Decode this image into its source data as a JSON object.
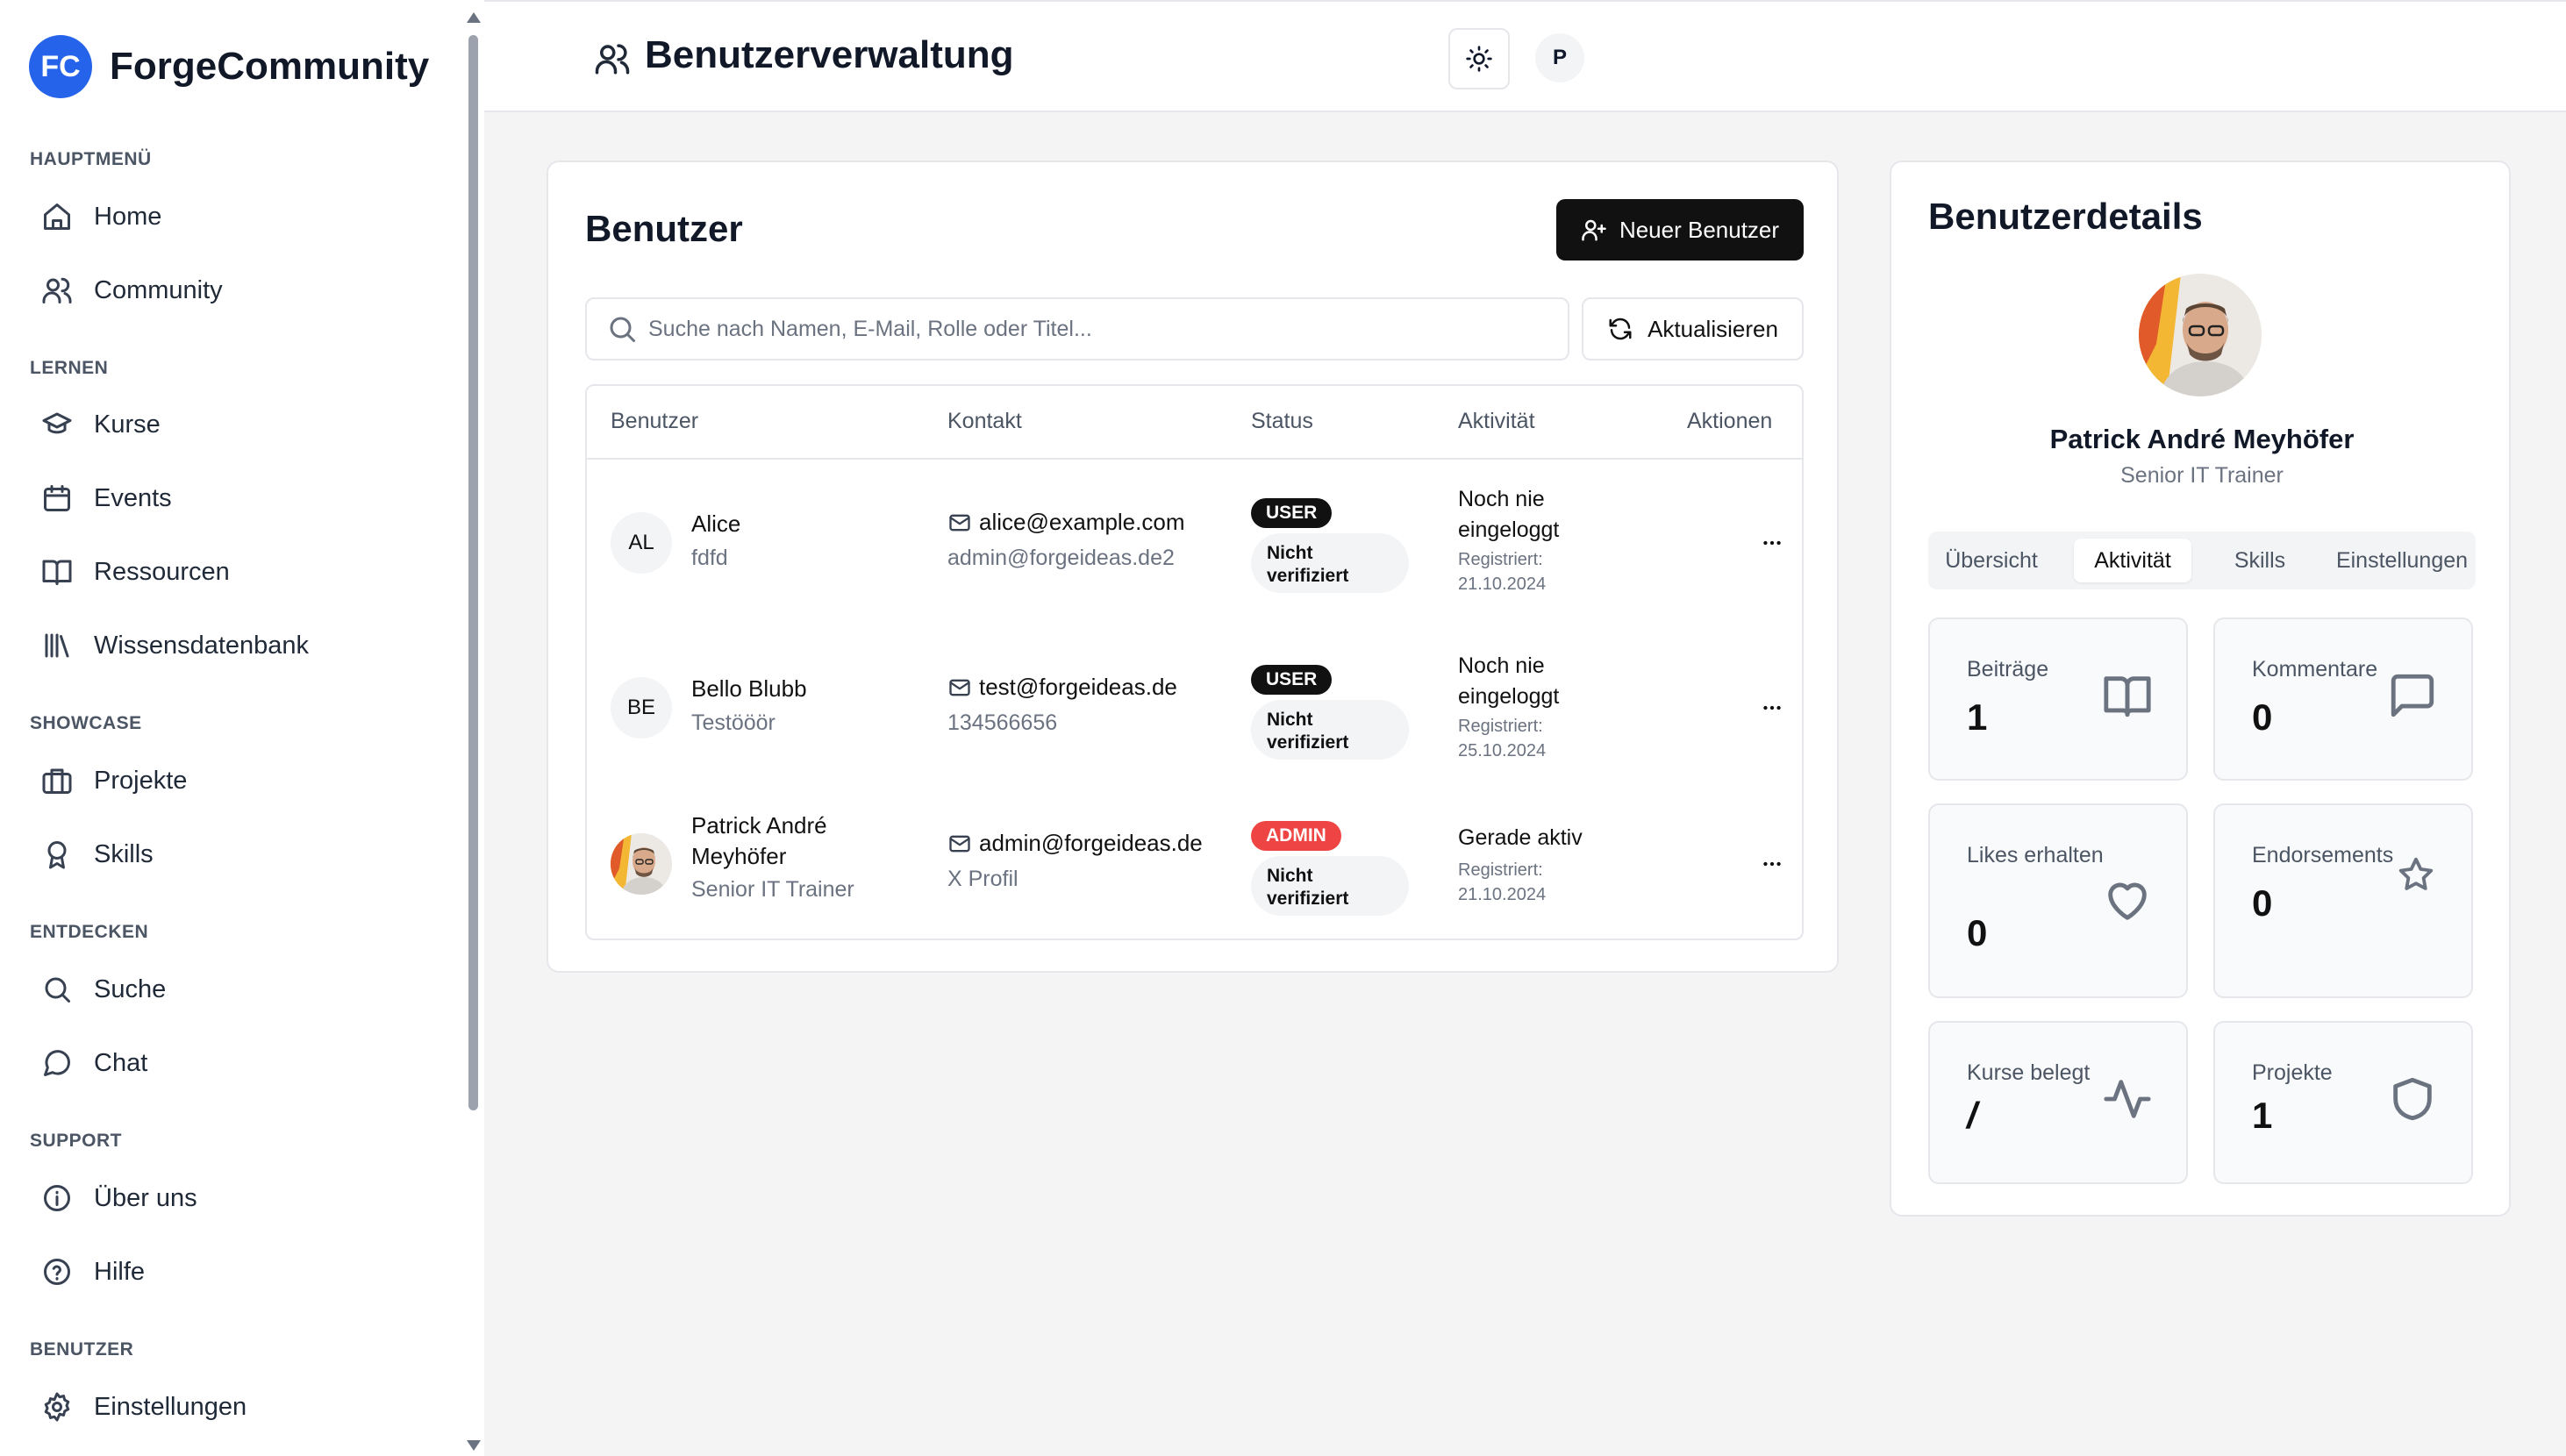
{
  "app": {
    "logo_initials": "FC",
    "name": "ForgeCommunity"
  },
  "sidebar": {
    "sections": [
      {
        "label": "HAUPTMENÜ",
        "items": [
          {
            "label": "Home",
            "icon": "home-icon"
          },
          {
            "label": "Community",
            "icon": "users-icon"
          }
        ]
      },
      {
        "label": "LERNEN",
        "items": [
          {
            "label": "Kurse",
            "icon": "graduation-cap-icon"
          },
          {
            "label": "Events",
            "icon": "calendar-icon"
          },
          {
            "label": "Ressourcen",
            "icon": "book-open-icon"
          },
          {
            "label": "Wissensdatenbank",
            "icon": "library-icon"
          }
        ]
      },
      {
        "label": "SHOWCASE",
        "items": [
          {
            "label": "Projekte",
            "icon": "briefcase-icon"
          },
          {
            "label": "Skills",
            "icon": "award-icon"
          }
        ]
      },
      {
        "label": "ENTDECKEN",
        "items": [
          {
            "label": "Suche",
            "icon": "search-icon"
          },
          {
            "label": "Chat",
            "icon": "message-circle-icon"
          }
        ]
      },
      {
        "label": "SUPPORT",
        "items": [
          {
            "label": "Über uns",
            "icon": "info-icon"
          },
          {
            "label": "Hilfe",
            "icon": "help-circle-icon"
          }
        ]
      },
      {
        "label": "BENUTZER",
        "items": [
          {
            "label": "Einstellungen",
            "icon": "settings-icon"
          }
        ]
      }
    ]
  },
  "header": {
    "title": "Benutzerverwaltung",
    "user_initial": "P"
  },
  "users": {
    "title": "Benutzer",
    "new_user_label": "Neuer Benutzer",
    "search_placeholder": "Suche nach Namen, E-Mail, Rolle oder Titel...",
    "refresh_label": "Aktualisieren",
    "columns": [
      "Benutzer",
      "Kontakt",
      "Status",
      "Aktivität",
      "Aktionen"
    ],
    "rows": [
      {
        "initials": "AL",
        "name": "Alice",
        "subtitle": "fdfd",
        "email": "alice@example.com",
        "contact2": "admin@forgeideas.de2",
        "role": "USER",
        "verification": "Nicht verifiziert",
        "activity": "Noch nie eingeloggt",
        "registered": "Registriert: 21.10.2024"
      },
      {
        "initials": "BE",
        "name": "Bello Blubb",
        "subtitle": "Testööör",
        "email": "test@forgeideas.de",
        "contact2": "134566656",
        "role": "USER",
        "verification": "Nicht verifiziert",
        "activity": "Noch nie eingeloggt",
        "registered": "Registriert: 25.10.2024"
      },
      {
        "initials": "",
        "name": "Patrick André Meyhöfer",
        "subtitle": "Senior IT Trainer",
        "email": "admin@forgeideas.de",
        "contact2": "X Profil",
        "role": "ADMIN",
        "verification": "Nicht verifiziert",
        "activity": "Gerade aktiv",
        "registered": "Registriert: 21.10.2024"
      }
    ],
    "role_colors": {
      "USER": "#111111",
      "ADMIN": "#ef4444"
    }
  },
  "details": {
    "title": "Benutzerdetails",
    "name": "Patrick André Meyhöfer",
    "subtitle": "Senior IT Trainer",
    "tabs": [
      "Übersicht",
      "Aktivität",
      "Skills",
      "Einstellungen"
    ],
    "active_tab": "Aktivität",
    "stats": [
      {
        "label": "Beiträge",
        "value": "1",
        "icon": "book-open-icon"
      },
      {
        "label": "Kommentare",
        "value": "0",
        "icon": "message-square-icon"
      },
      {
        "label": "Likes erhalten",
        "value": "0",
        "icon": "heart-icon"
      },
      {
        "label": "Endorsements",
        "value": "0",
        "icon": "star-icon"
      },
      {
        "label": "Kurse belegt",
        "value": "/",
        "icon": "activity-icon"
      },
      {
        "label": "Projekte",
        "value": "1",
        "icon": "shield-icon"
      }
    ]
  }
}
